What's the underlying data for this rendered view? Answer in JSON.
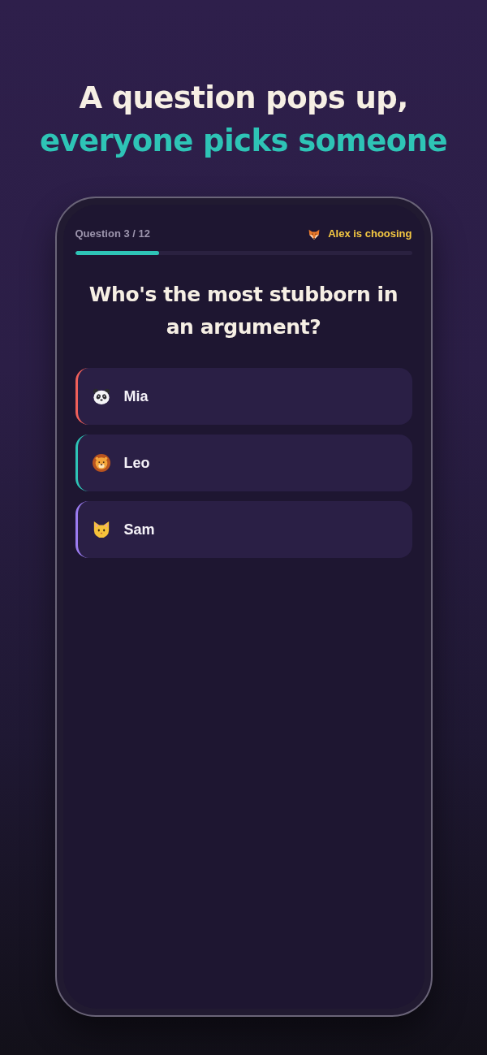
{
  "headline": {
    "lines": [
      {
        "text": "A question pops up,",
        "kind": "plain"
      },
      {
        "text": "everyone picks someone",
        "kind": "accent"
      }
    ]
  },
  "quiz": {
    "counter": "Question 3 / 12",
    "chooser": {
      "kind": "fox",
      "text": "Alex is choosing"
    },
    "progress": {
      "level": 0.25
    },
    "question": "Who's the most stubborn in an argument?",
    "options": [
      {
        "name": "Mia",
        "kind": "panda",
        "color": "#f0605a",
        "selected": false
      },
      {
        "name": "Leo",
        "kind": "lion",
        "color": "#2ec4b6",
        "selected": false
      },
      {
        "name": "Sam",
        "kind": "cat",
        "color": "#9b7cf0",
        "selected": false
      }
    ]
  }
}
